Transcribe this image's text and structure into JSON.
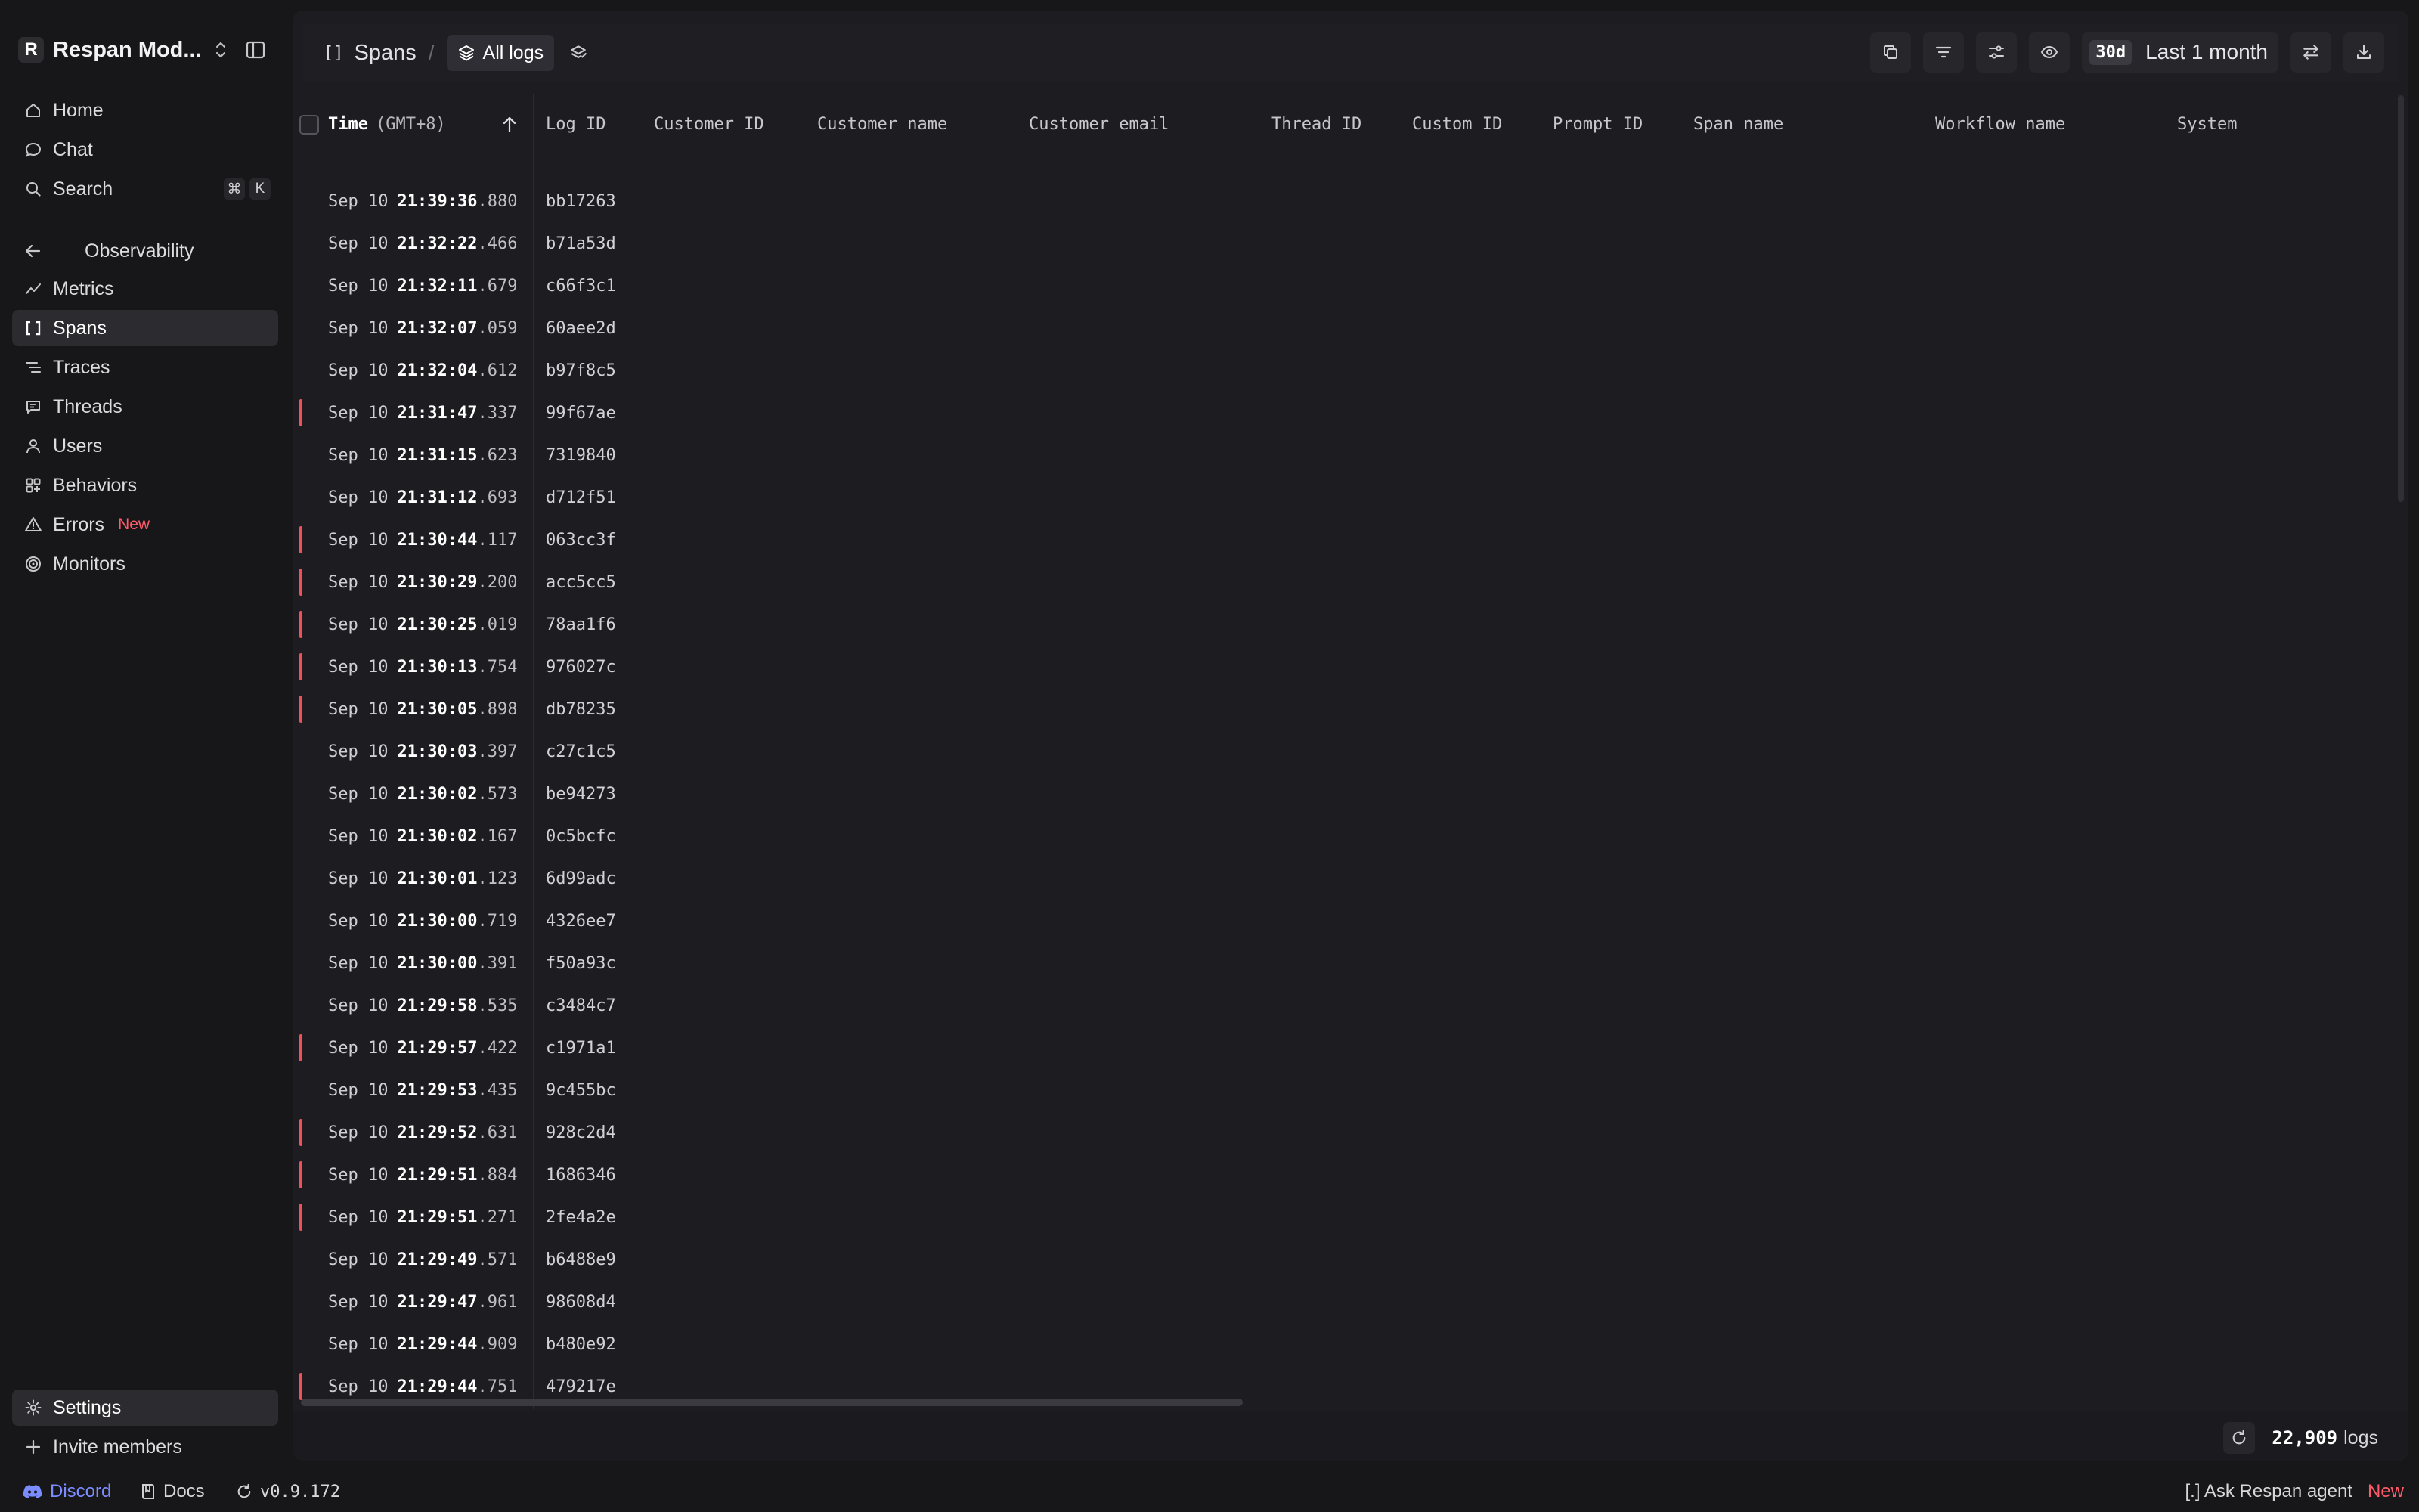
{
  "workspace": {
    "avatar": "R",
    "name": "Respan Mod..."
  },
  "nav": {
    "home": "Home",
    "chat": "Chat",
    "search": "Search",
    "search_kbd": [
      "⌘",
      "K"
    ],
    "section_title": "Observability",
    "items": [
      {
        "label": "Metrics",
        "icon": "line-chart-icon"
      },
      {
        "label": "Spans",
        "icon": "brackets-icon",
        "active": true
      },
      {
        "label": "Traces",
        "icon": "traces-icon"
      },
      {
        "label": "Threads",
        "icon": "message-square-icon"
      },
      {
        "label": "Users",
        "icon": "user-icon"
      },
      {
        "label": "Behaviors",
        "icon": "grid-icon"
      },
      {
        "label": "Errors",
        "icon": "warning-icon",
        "badge": "New"
      },
      {
        "label": "Monitors",
        "icon": "radar-icon"
      }
    ],
    "settings": "Settings",
    "invite": "Invite members"
  },
  "bottombar": {
    "discord": "Discord",
    "docs": "Docs",
    "version": "v0.9.172",
    "agent": "[.] Ask Respan agent",
    "agent_badge": "New"
  },
  "toolbar": {
    "crumb_icon": "[]",
    "crumb": "Spans",
    "view": "All logs",
    "range_badge": "30d",
    "range_label": "Last 1 month"
  },
  "table": {
    "columns": {
      "time": "Time",
      "time_tz": "(GMT+8)",
      "log_id": "Log ID",
      "customer_id": "Customer ID",
      "customer_name": "Customer name",
      "customer_email": "Customer email",
      "thread_id": "Thread ID",
      "custom_id": "Custom ID",
      "prompt_id": "Prompt ID",
      "span_name": "Span name",
      "workflow_name": "Workflow name",
      "system": "System"
    },
    "rows": [
      {
        "date": "Sep 10",
        "hms": "21:39:36",
        "ms": ".880",
        "id": "bb17263",
        "error": false
      },
      {
        "date": "Sep 10",
        "hms": "21:32:22",
        "ms": ".466",
        "id": "b71a53d",
        "error": false
      },
      {
        "date": "Sep 10",
        "hms": "21:32:11",
        "ms": ".679",
        "id": "c66f3c1",
        "error": false
      },
      {
        "date": "Sep 10",
        "hms": "21:32:07",
        "ms": ".059",
        "id": "60aee2d",
        "error": false
      },
      {
        "date": "Sep 10",
        "hms": "21:32:04",
        "ms": ".612",
        "id": "b97f8c5",
        "error": false
      },
      {
        "date": "Sep 10",
        "hms": "21:31:47",
        "ms": ".337",
        "id": "99f67ae",
        "error": true
      },
      {
        "date": "Sep 10",
        "hms": "21:31:15",
        "ms": ".623",
        "id": "7319840",
        "error": false
      },
      {
        "date": "Sep 10",
        "hms": "21:31:12",
        "ms": ".693",
        "id": "d712f51",
        "error": false
      },
      {
        "date": "Sep 10",
        "hms": "21:30:44",
        "ms": ".117",
        "id": "063cc3f",
        "error": true
      },
      {
        "date": "Sep 10",
        "hms": "21:30:29",
        "ms": ".200",
        "id": "acc5cc5",
        "error": true
      },
      {
        "date": "Sep 10",
        "hms": "21:30:25",
        "ms": ".019",
        "id": "78aa1f6",
        "error": true
      },
      {
        "date": "Sep 10",
        "hms": "21:30:13",
        "ms": ".754",
        "id": "976027c",
        "error": true
      },
      {
        "date": "Sep 10",
        "hms": "21:30:05",
        "ms": ".898",
        "id": "db78235",
        "error": true
      },
      {
        "date": "Sep 10",
        "hms": "21:30:03",
        "ms": ".397",
        "id": "c27c1c5",
        "error": false
      },
      {
        "date": "Sep 10",
        "hms": "21:30:02",
        "ms": ".573",
        "id": "be94273",
        "error": false
      },
      {
        "date": "Sep 10",
        "hms": "21:30:02",
        "ms": ".167",
        "id": "0c5bcfc",
        "error": false
      },
      {
        "date": "Sep 10",
        "hms": "21:30:01",
        "ms": ".123",
        "id": "6d99adc",
        "error": false
      },
      {
        "date": "Sep 10",
        "hms": "21:30:00",
        "ms": ".719",
        "id": "4326ee7",
        "error": false
      },
      {
        "date": "Sep 10",
        "hms": "21:30:00",
        "ms": ".391",
        "id": "f50a93c",
        "error": false
      },
      {
        "date": "Sep 10",
        "hms": "21:29:58",
        "ms": ".535",
        "id": "c3484c7",
        "error": false
      },
      {
        "date": "Sep 10",
        "hms": "21:29:57",
        "ms": ".422",
        "id": "c1971a1",
        "error": true
      },
      {
        "date": "Sep 10",
        "hms": "21:29:53",
        "ms": ".435",
        "id": "9c455bc",
        "error": false
      },
      {
        "date": "Sep 10",
        "hms": "21:29:52",
        "ms": ".631",
        "id": "928c2d4",
        "error": true
      },
      {
        "date": "Sep 10",
        "hms": "21:29:51",
        "ms": ".884",
        "id": "1686346",
        "error": true
      },
      {
        "date": "Sep 10",
        "hms": "21:29:51",
        "ms": ".271",
        "id": "2fe4a2e",
        "error": true
      },
      {
        "date": "Sep 10",
        "hms": "21:29:49",
        "ms": ".571",
        "id": "b6488e9",
        "error": false
      },
      {
        "date": "Sep 10",
        "hms": "21:29:47",
        "ms": ".961",
        "id": "98608d4",
        "error": false
      },
      {
        "date": "Sep 10",
        "hms": "21:29:44",
        "ms": ".909",
        "id": "b480e92",
        "error": false
      },
      {
        "date": "Sep 10",
        "hms": "21:29:44",
        "ms": ".751",
        "id": "479217e",
        "error": true
      }
    ]
  },
  "footer": {
    "count": "22,909",
    "count_label": "logs"
  },
  "colors": {
    "error_marker": "#f0505c",
    "new_badge": "#ff5b6a",
    "discord": "#7b8cff"
  }
}
